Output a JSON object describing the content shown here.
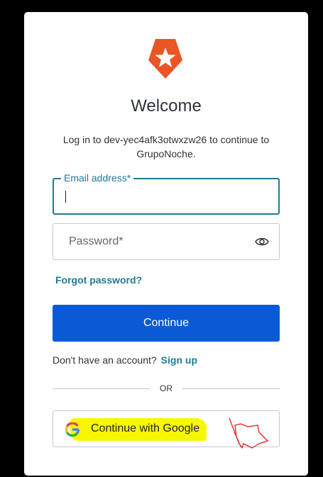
{
  "brand": {
    "logo_icon": "shield-star-icon",
    "color": "#eb5424"
  },
  "welcome": {
    "title": "Welcome",
    "subtitle": "Log in to dev-yec4afk3otwxzw26 to continue to GrupoNoche."
  },
  "form": {
    "email_label": "Email address*",
    "email_value": "",
    "password_placeholder": "Password*",
    "show_password_icon": "eye-icon",
    "forgot_link": "Forgot password?",
    "continue_label": "Continue"
  },
  "signup": {
    "prompt": "Don't have an account?",
    "link": "Sign up"
  },
  "divider": {
    "text": "OR"
  },
  "social": {
    "google_label": "Continue with Google",
    "google_icon": "google-g-icon"
  },
  "colors": {
    "accent": "#1f7996",
    "primary_button": "#0a5ad6",
    "highlight": "#f7f700",
    "annotation": "#e41e1e"
  }
}
